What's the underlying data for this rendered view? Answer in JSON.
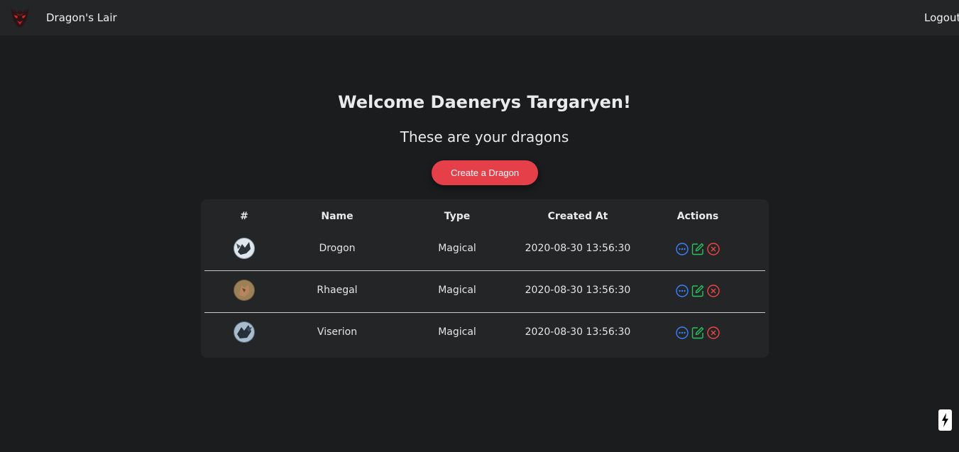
{
  "nav": {
    "brand": "Dragon's Lair",
    "logout": "Logout"
  },
  "hero": {
    "welcome": "Welcome Daenerys Targaryen!",
    "subtitle": "These are your dragons",
    "create_button": "Create a Dragon"
  },
  "table": {
    "headers": {
      "index": "#",
      "name": "Name",
      "type": "Type",
      "created_at": "Created At",
      "actions": "Actions"
    },
    "rows": [
      {
        "name": "Drogon",
        "type": "Magical",
        "created_at": "2020-08-30 13:56:30"
      },
      {
        "name": "Rhaegal",
        "type": "Magical",
        "created_at": "2020-08-30 13:56:30"
      },
      {
        "name": "Viserion",
        "type": "Magical",
        "created_at": "2020-08-30 13:56:30"
      }
    ],
    "action_icons": [
      "more-icon",
      "edit-icon",
      "delete-icon"
    ]
  },
  "colors": {
    "background": "#1b1c1e",
    "navbar": "#242527",
    "accent": "#e5404a",
    "view_blue": "#3b82f6",
    "edit_green": "#22c55e",
    "delete_red": "#ef4444"
  }
}
